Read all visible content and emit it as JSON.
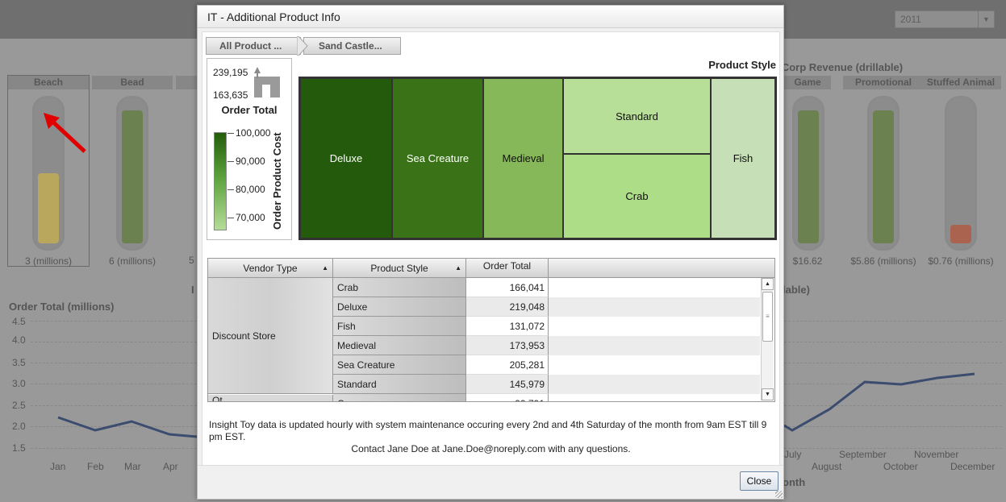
{
  "background": {
    "year": "2011",
    "revenue_title": "a Corp Revenue (drillable)",
    "gauges": [
      {
        "name": "Beach",
        "value": "3 (millions)",
        "fill_fraction": 0.5,
        "fill_color": "#b8a75c"
      },
      {
        "name": "Bead",
        "value": "6 (millions)",
        "fill_fraction": 0.95,
        "fill_color": "#6b8250"
      },
      {
        "name": "Game",
        "value": "$16.62",
        "fill_fraction": 0.95,
        "fill_color": "#6b8250"
      },
      {
        "name": "Promotional",
        "value": "$5.86 (millions)",
        "fill_fraction": 0.95,
        "fill_color": "#6b8250"
      },
      {
        "name": "Stuffed Animal",
        "value": "$0.76 (millions)",
        "fill_fraction": 0.13,
        "fill_color": "#a9634e"
      }
    ],
    "partial_value": "5",
    "order_total_title": "Order Total (millions)",
    "right_chart_title": "lable)",
    "left_i": "I",
    "month_axis_title": "onth",
    "y_ticks": [
      "4.5",
      "4.0",
      "3.5",
      "3.0",
      "2.5",
      "2.0",
      "1.5"
    ],
    "months_left": [
      "Jan",
      "Feb",
      "Mar",
      "Apr"
    ],
    "months_right": [
      "July",
      "August",
      "September",
      "October",
      "November",
      "December"
    ]
  },
  "modal": {
    "title": "IT - Additional Product Info",
    "breadcrumbs": [
      "All Product ...",
      "Sand Castle..."
    ],
    "legend": {
      "size_max": "239,195",
      "size_min": "163,635",
      "size_label": "Order Total",
      "color_label": "Order Product Cost",
      "color_ticks": [
        "100,000",
        "90,000",
        "80,000",
        "70,000"
      ]
    },
    "treemap_title": "Product Style",
    "treemap": [
      {
        "label": "Deluxe",
        "color": "#245a0c",
        "text_color": "#ffffff"
      },
      {
        "label": "Sea Creature",
        "color": "#3a7317",
        "text_color": "#ffffff"
      },
      {
        "label": "Medieval",
        "color": "#86b859",
        "text_color": "#111111"
      },
      {
        "label": "Standard",
        "color": "#b8df98",
        "text_color": "#111111"
      },
      {
        "label": "Crab",
        "color": "#addd87",
        "text_color": "#111111"
      },
      {
        "label": "Fish",
        "color": "#c7dfb6",
        "text_color": "#111111"
      }
    ],
    "table": {
      "headers": [
        "Vendor Type",
        "Product Style",
        "Order Total"
      ],
      "vendor": "Discount Store",
      "next_vendor": "Ot",
      "rows": [
        {
          "style": "Crab",
          "total": "166,041"
        },
        {
          "style": "Deluxe",
          "total": "219,048"
        },
        {
          "style": "Fish",
          "total": "131,072"
        },
        {
          "style": "Medieval",
          "total": "173,953"
        },
        {
          "style": "Sea Creature",
          "total": "205,281"
        },
        {
          "style": "Standard",
          "total": "145,979"
        }
      ],
      "partial_row": {
        "style": "Cr",
        "total": "99,791"
      }
    },
    "info_text": "Insight Toy data is updated hourly with system maintenance occuring every 2nd and 4th Saturday of the month from 9am EST till 9 pm EST.",
    "contact_text": "Contact Jane Doe at Jane.Doe@noreply.com with any questions.",
    "close_label": "Close"
  }
}
